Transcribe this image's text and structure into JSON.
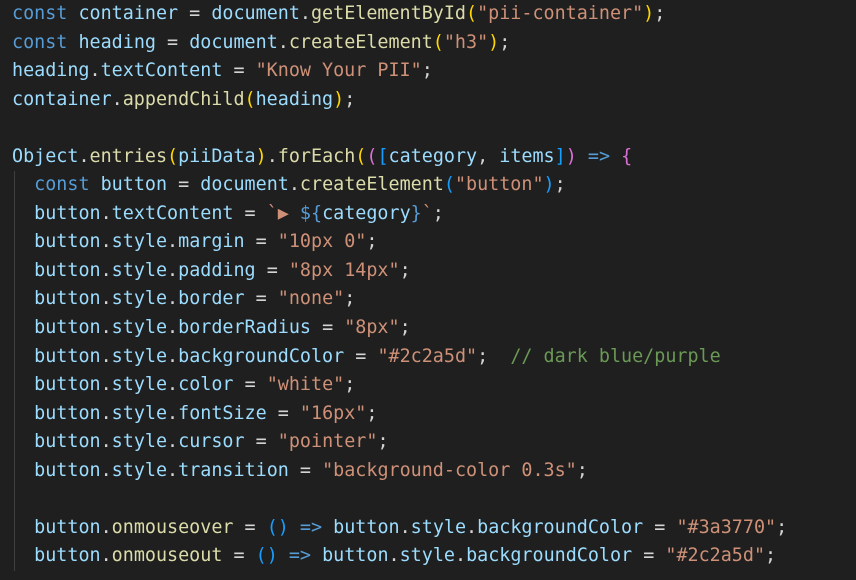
{
  "editor": {
    "lines": [
      [
        [
          "kw",
          "const"
        ],
        [
          "op",
          " "
        ],
        [
          "var",
          "container"
        ],
        [
          "op",
          " = "
        ],
        [
          "var",
          "document"
        ],
        [
          "op",
          "."
        ],
        [
          "fn",
          "getElementById"
        ],
        [
          "br1",
          "("
        ],
        [
          "str",
          "\"pii-container\""
        ],
        [
          "br1",
          ")"
        ],
        [
          "op",
          ";"
        ]
      ],
      [
        [
          "kw",
          "const"
        ],
        [
          "op",
          " "
        ],
        [
          "var",
          "heading"
        ],
        [
          "op",
          " = "
        ],
        [
          "var",
          "document"
        ],
        [
          "op",
          "."
        ],
        [
          "fn",
          "createElement"
        ],
        [
          "br1",
          "("
        ],
        [
          "str",
          "\"h3\""
        ],
        [
          "br1",
          ")"
        ],
        [
          "op",
          ";"
        ]
      ],
      [
        [
          "var",
          "heading"
        ],
        [
          "op",
          "."
        ],
        [
          "var",
          "textContent"
        ],
        [
          "op",
          " = "
        ],
        [
          "str",
          "\"Know Your PII\""
        ],
        [
          "op",
          ";"
        ]
      ],
      [
        [
          "var",
          "container"
        ],
        [
          "op",
          "."
        ],
        [
          "fn",
          "appendChild"
        ],
        [
          "br1",
          "("
        ],
        [
          "var",
          "heading"
        ],
        [
          "br1",
          ")"
        ],
        [
          "op",
          ";"
        ]
      ],
      [],
      [
        [
          "var",
          "Object"
        ],
        [
          "op",
          "."
        ],
        [
          "fn",
          "entries"
        ],
        [
          "br1",
          "("
        ],
        [
          "var",
          "piiData"
        ],
        [
          "br1",
          ")"
        ],
        [
          "op",
          "."
        ],
        [
          "fn",
          "forEach"
        ],
        [
          "br1",
          "("
        ],
        [
          "br2",
          "("
        ],
        [
          "br3",
          "["
        ],
        [
          "var",
          "category"
        ],
        [
          "op",
          ", "
        ],
        [
          "var",
          "items"
        ],
        [
          "br3",
          "]"
        ],
        [
          "br2",
          ")"
        ],
        [
          "op",
          " "
        ],
        [
          "kw",
          "=>"
        ],
        [
          "op",
          " "
        ],
        [
          "br2",
          "{"
        ]
      ],
      [
        [
          "op",
          "  "
        ],
        [
          "kw",
          "const"
        ],
        [
          "op",
          " "
        ],
        [
          "var",
          "button"
        ],
        [
          "op",
          " = "
        ],
        [
          "var",
          "document"
        ],
        [
          "op",
          "."
        ],
        [
          "fn",
          "createElement"
        ],
        [
          "br3",
          "("
        ],
        [
          "str",
          "\"button\""
        ],
        [
          "br3",
          ")"
        ],
        [
          "op",
          ";"
        ]
      ],
      [
        [
          "op",
          "  "
        ],
        [
          "var",
          "button"
        ],
        [
          "op",
          "."
        ],
        [
          "var",
          "textContent"
        ],
        [
          "op",
          " = "
        ],
        [
          "str",
          "`▶ "
        ],
        [
          "tpl",
          "${"
        ],
        [
          "var",
          "category"
        ],
        [
          "tpl",
          "}"
        ],
        [
          "str",
          "`"
        ],
        [
          "op",
          ";"
        ]
      ],
      [
        [
          "op",
          "  "
        ],
        [
          "var",
          "button"
        ],
        [
          "op",
          "."
        ],
        [
          "var",
          "style"
        ],
        [
          "op",
          "."
        ],
        [
          "var",
          "margin"
        ],
        [
          "op",
          " = "
        ],
        [
          "str",
          "\"10px 0\""
        ],
        [
          "op",
          ";"
        ]
      ],
      [
        [
          "op",
          "  "
        ],
        [
          "var",
          "button"
        ],
        [
          "op",
          "."
        ],
        [
          "var",
          "style"
        ],
        [
          "op",
          "."
        ],
        [
          "var",
          "padding"
        ],
        [
          "op",
          " = "
        ],
        [
          "str",
          "\"8px 14px\""
        ],
        [
          "op",
          ";"
        ]
      ],
      [
        [
          "op",
          "  "
        ],
        [
          "var",
          "button"
        ],
        [
          "op",
          "."
        ],
        [
          "var",
          "style"
        ],
        [
          "op",
          "."
        ],
        [
          "var",
          "border"
        ],
        [
          "op",
          " = "
        ],
        [
          "str",
          "\"none\""
        ],
        [
          "op",
          ";"
        ]
      ],
      [
        [
          "op",
          "  "
        ],
        [
          "var",
          "button"
        ],
        [
          "op",
          "."
        ],
        [
          "var",
          "style"
        ],
        [
          "op",
          "."
        ],
        [
          "var",
          "borderRadius"
        ],
        [
          "op",
          " = "
        ],
        [
          "str",
          "\"8px\""
        ],
        [
          "op",
          ";"
        ]
      ],
      [
        [
          "op",
          "  "
        ],
        [
          "var",
          "button"
        ],
        [
          "op",
          "."
        ],
        [
          "var",
          "style"
        ],
        [
          "op",
          "."
        ],
        [
          "var",
          "backgroundColor"
        ],
        [
          "op",
          " = "
        ],
        [
          "str",
          "\"#2c2a5d\""
        ],
        [
          "op",
          ";  "
        ],
        [
          "cmt",
          "// dark blue/purple"
        ]
      ],
      [
        [
          "op",
          "  "
        ],
        [
          "var",
          "button"
        ],
        [
          "op",
          "."
        ],
        [
          "var",
          "style"
        ],
        [
          "op",
          "."
        ],
        [
          "var",
          "color"
        ],
        [
          "op",
          " = "
        ],
        [
          "str",
          "\"white\""
        ],
        [
          "op",
          ";"
        ]
      ],
      [
        [
          "op",
          "  "
        ],
        [
          "var",
          "button"
        ],
        [
          "op",
          "."
        ],
        [
          "var",
          "style"
        ],
        [
          "op",
          "."
        ],
        [
          "var",
          "fontSize"
        ],
        [
          "op",
          " = "
        ],
        [
          "str",
          "\"16px\""
        ],
        [
          "op",
          ";"
        ]
      ],
      [
        [
          "op",
          "  "
        ],
        [
          "var",
          "button"
        ],
        [
          "op",
          "."
        ],
        [
          "var",
          "style"
        ],
        [
          "op",
          "."
        ],
        [
          "var",
          "cursor"
        ],
        [
          "op",
          " = "
        ],
        [
          "str",
          "\"pointer\""
        ],
        [
          "op",
          ";"
        ]
      ],
      [
        [
          "op",
          "  "
        ],
        [
          "var",
          "button"
        ],
        [
          "op",
          "."
        ],
        [
          "var",
          "style"
        ],
        [
          "op",
          "."
        ],
        [
          "var",
          "transition"
        ],
        [
          "op",
          " = "
        ],
        [
          "str",
          "\"background-color 0.3s\""
        ],
        [
          "op",
          ";"
        ]
      ],
      [],
      [
        [
          "op",
          "  "
        ],
        [
          "var",
          "button"
        ],
        [
          "op",
          "."
        ],
        [
          "fn",
          "onmouseover"
        ],
        [
          "op",
          " = "
        ],
        [
          "br3",
          "("
        ],
        [
          "br3",
          ")"
        ],
        [
          "op",
          " "
        ],
        [
          "kw",
          "=>"
        ],
        [
          "op",
          " "
        ],
        [
          "var",
          "button"
        ],
        [
          "op",
          "."
        ],
        [
          "var",
          "style"
        ],
        [
          "op",
          "."
        ],
        [
          "var",
          "backgroundColor"
        ],
        [
          "op",
          " = "
        ],
        [
          "str",
          "\"#3a3770\""
        ],
        [
          "op",
          ";"
        ]
      ],
      [
        [
          "op",
          "  "
        ],
        [
          "var",
          "button"
        ],
        [
          "op",
          "."
        ],
        [
          "fn",
          "onmouseout"
        ],
        [
          "op",
          " = "
        ],
        [
          "br3",
          "("
        ],
        [
          "br3",
          ")"
        ],
        [
          "op",
          " "
        ],
        [
          "kw",
          "=>"
        ],
        [
          "op",
          " "
        ],
        [
          "var",
          "button"
        ],
        [
          "op",
          "."
        ],
        [
          "var",
          "style"
        ],
        [
          "op",
          "."
        ],
        [
          "var",
          "backgroundColor"
        ],
        [
          "op",
          " = "
        ],
        [
          "str",
          "\"#2c2a5d\""
        ],
        [
          "op",
          ";"
        ]
      ]
    ],
    "indent_guide_from_line": 6,
    "colors": {
      "background": "#1f1f1f",
      "keyword": "#569cd6",
      "variable": "#9cdcfe",
      "function": "#dcdcaa",
      "string": "#ce9178",
      "comment": "#6a9955",
      "bracket_level_1": "#ffd700",
      "bracket_level_2": "#da70d6",
      "bracket_level_3": "#179fff"
    }
  }
}
